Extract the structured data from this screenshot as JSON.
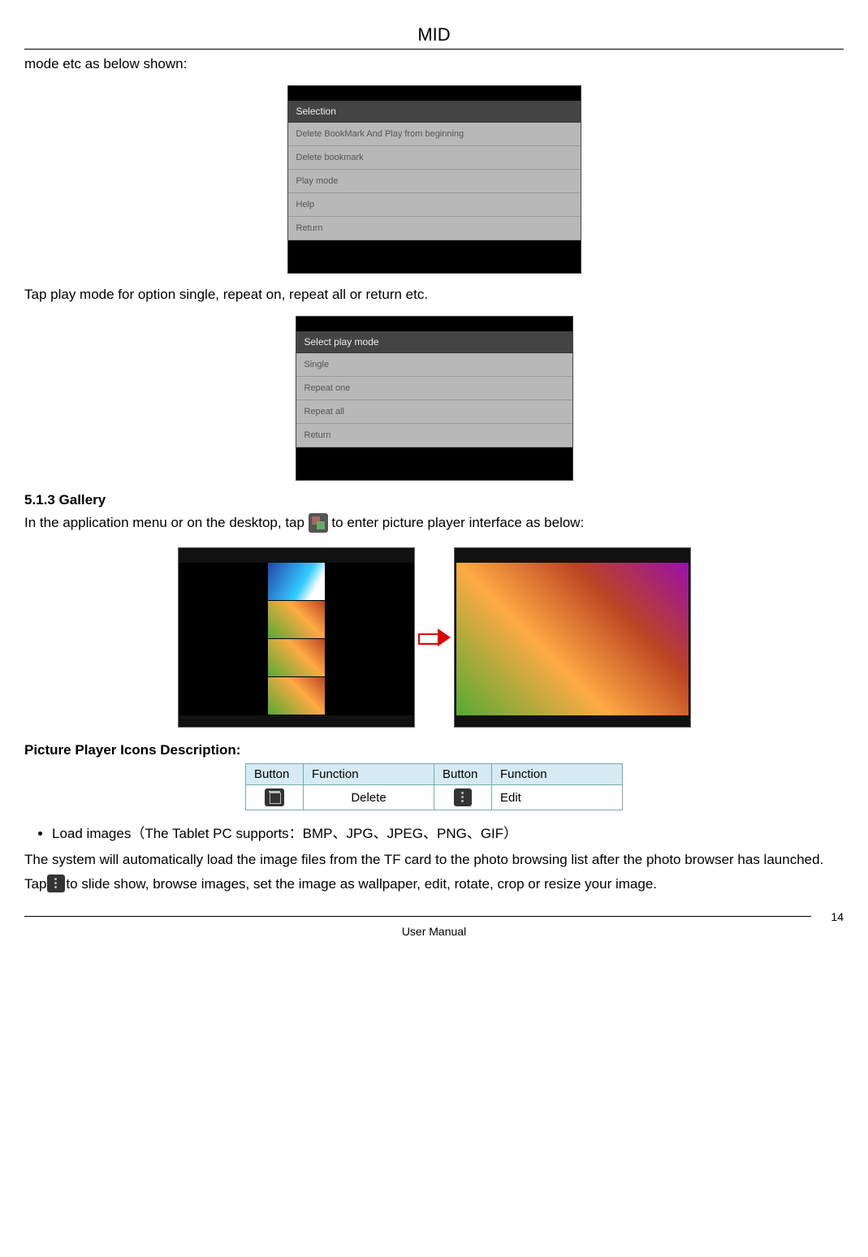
{
  "header": {
    "title": "MID"
  },
  "intro_line": "mode etc as below shown:",
  "menu1": {
    "header": "Selection",
    "items": [
      "Delete BookMark And Play from beginning",
      "Delete bookmark",
      "Play mode",
      "Help",
      "Return"
    ]
  },
  "play_mode_line": "Tap play mode for option single, repeat on, repeat all or return etc.",
  "menu2": {
    "header": "Select play mode",
    "items": [
      "Single",
      "Repeat one",
      "Repeat all",
      "Return"
    ]
  },
  "section_gallery": "5.1.3 Gallery",
  "gallery_line_a": "In the application menu or on the desktop, tap ",
  "gallery_line_b": " to enter picture player interface as below:",
  "icons_heading": "Picture Player Icons Description:",
  "icons_table": {
    "headers": [
      "Button",
      "Function",
      "Button",
      "Function"
    ],
    "row": {
      "func1": "Delete",
      "func2": "Edit"
    }
  },
  "bullet_load": "Load images（The Tablet PC supports：BMP、JPG、JPEG、PNG、GIF）",
  "load_para": "The system will automatically load the image files from the TF card to the photo browsing list after the photo browser has launched.",
  "tap_line_a": "Tap",
  "tap_line_b": "to slide show, browse images, set the image as wallpaper, edit, rotate, crop or resize your image.",
  "footer": {
    "label": "User Manual",
    "page": "14"
  }
}
